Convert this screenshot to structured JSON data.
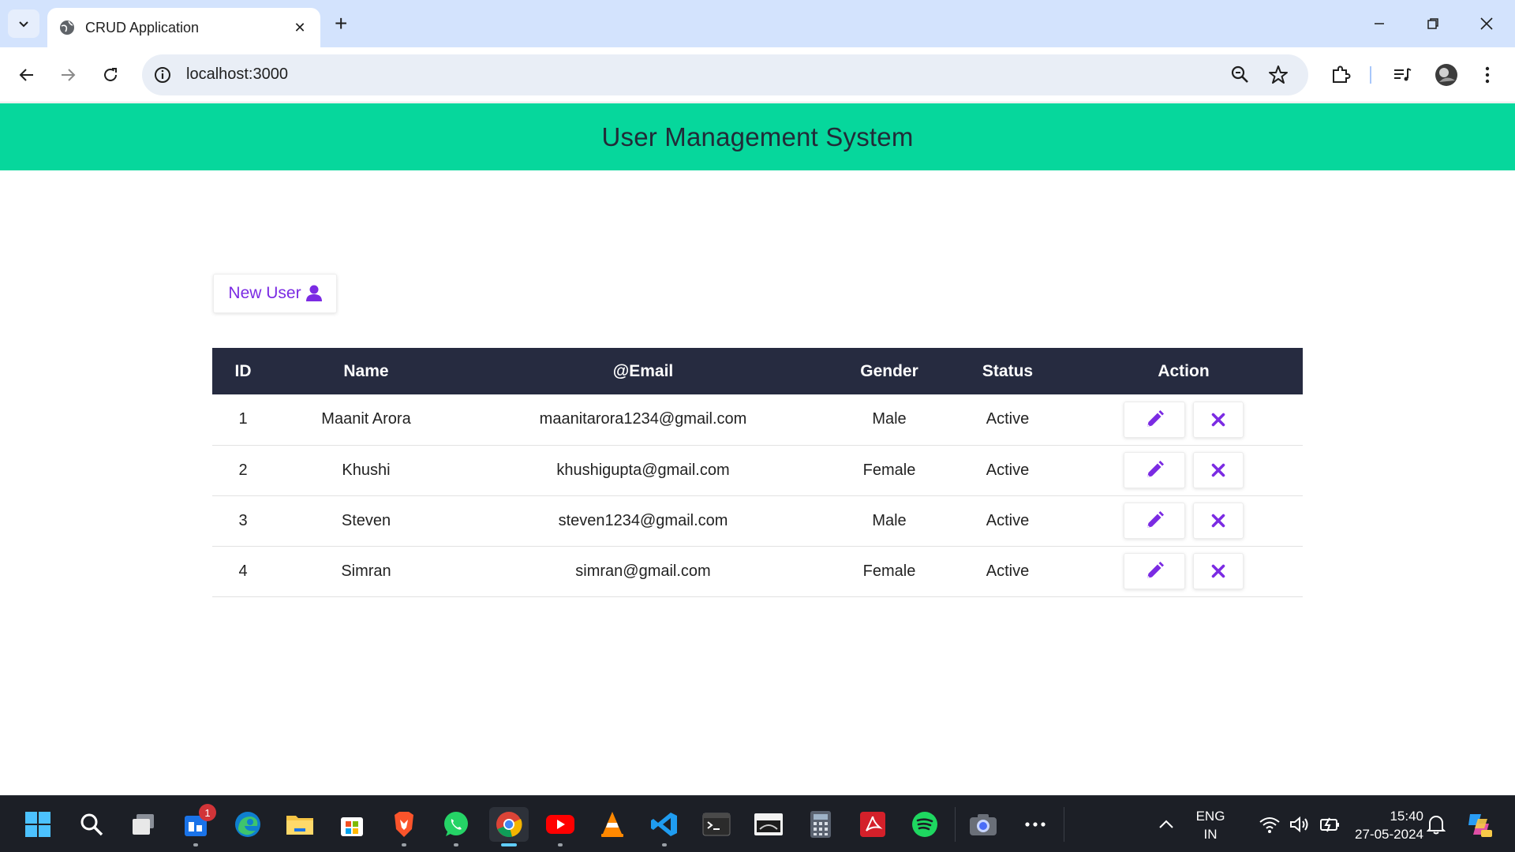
{
  "browser": {
    "tab_title": "CRUD Application",
    "url": "localhost:3000"
  },
  "app": {
    "header_title": "User Management System",
    "new_user_label": "New User",
    "columns": [
      "ID",
      "Name",
      "@Email",
      "Gender",
      "Status",
      "Action"
    ],
    "users": [
      {
        "id": "1",
        "name": "Maanit Arora",
        "email": "maanitarora1234@gmail.com",
        "gender": "Male",
        "status": "Active"
      },
      {
        "id": "2",
        "name": "Khushi",
        "email": "khushigupta@gmail.com",
        "gender": "Female",
        "status": "Active"
      },
      {
        "id": "3",
        "name": "Steven",
        "email": "steven1234@gmail.com",
        "gender": "Male",
        "status": "Active"
      },
      {
        "id": "4",
        "name": "Simran",
        "email": "simran@gmail.com",
        "gender": "Female",
        "status": "Active"
      }
    ],
    "colors": {
      "header_bg": "#06d79c",
      "table_header_bg": "#262b40",
      "accent": "#7b2be3"
    }
  },
  "taskbar": {
    "notification_badge": "1",
    "language": "ENG",
    "region": "IN",
    "time": "15:40",
    "date": "27-05-2024",
    "apps": [
      "start-icon",
      "search-icon",
      "task-view-icon",
      "widgets-icon",
      "edge-icon",
      "file-explorer-icon",
      "microsoft-store-icon",
      "brave-icon",
      "whatsapp-icon",
      "chrome-icon",
      "youtube-icon",
      "vlc-icon",
      "vscode-icon",
      "terminal-icon",
      "asphalt-icon",
      "calculator-icon",
      "acrobat-icon",
      "spotify-icon",
      "camera-icon",
      "more-icon"
    ]
  }
}
